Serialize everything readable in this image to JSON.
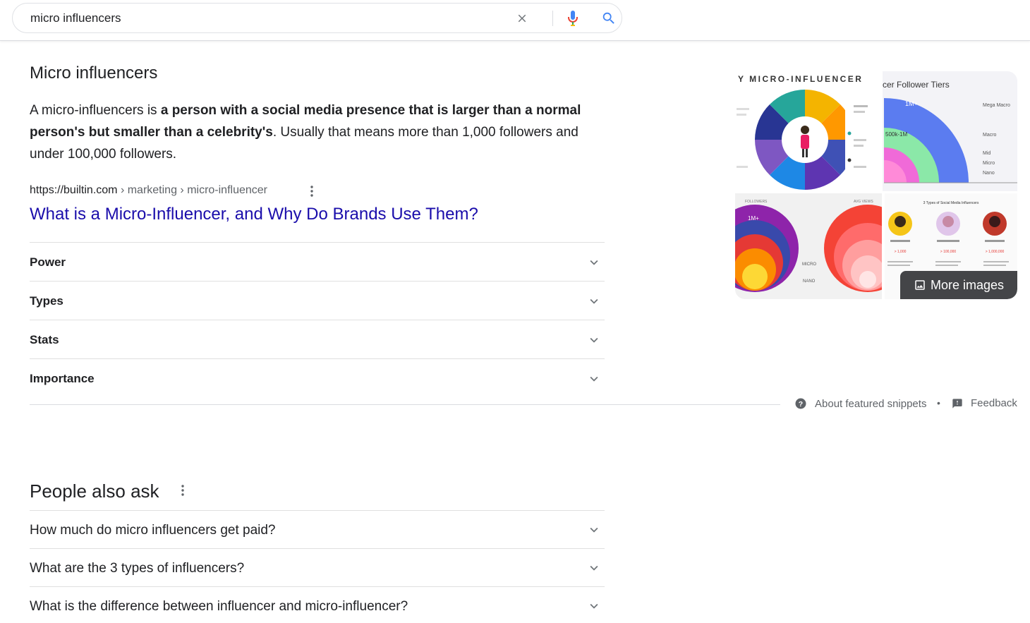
{
  "search": {
    "query": "micro influencers"
  },
  "snippet": {
    "title": "Micro influencers",
    "text_part1": "A micro-influencers is ",
    "text_bold": "a person with a social media presence that is larger than a normal person's but smaller than a celebrity's",
    "text_part2": ". Usually that means more than 1,000 followers and under 100,000 followers.",
    "source_domain": "https://builtin.com",
    "source_path": " › marketing › micro-influencer",
    "link_title": "What is a Micro-Influencer, and Why Do Brands Use Them?",
    "sections": [
      "Power",
      "Types",
      "Stats",
      "Importance"
    ],
    "about_label": "About featured snippets",
    "separator": "•",
    "feedback_label": "Feedback"
  },
  "images": {
    "tile1_heading": "Y MICRO-INFLUENCER",
    "tile2_heading": "cer Follower Tiers",
    "tile2_labels": [
      "1M+",
      "500k-1M",
      "Mega Macro",
      "Macro",
      "Mid",
      "Micro",
      "Nano"
    ],
    "tile3_labels": [
      "FOLLOWERS",
      "AVG VIEWS",
      "1M+",
      "MICRO",
      "NANO"
    ],
    "tile4_heading": "3 Types of Social Media Influencers",
    "tile4_values": [
      "> 1,000",
      "> 100,000",
      "> 1,000,000"
    ],
    "more_images_label": "More images"
  },
  "people_also_ask": {
    "title": "People also ask",
    "questions": [
      "How much do micro influencers get paid?",
      "What are the 3 types of influencers?",
      "What is the difference between influencer and micro-influencer?"
    ]
  },
  "colors": {
    "link": "#1a0dab",
    "text": "#202124",
    "secondary_text": "#5f6368",
    "divider": "#e0e0e0",
    "mic_blue": "#4285f4",
    "mic_red": "#ea4335"
  },
  "icons": {
    "clear": "close-icon",
    "mic": "microphone-icon",
    "search": "search-icon",
    "menu": "more-vert-icon",
    "chevron": "chevron-down-icon",
    "help": "help-circle-icon",
    "feedback": "feedback-icon",
    "image": "image-icon"
  }
}
